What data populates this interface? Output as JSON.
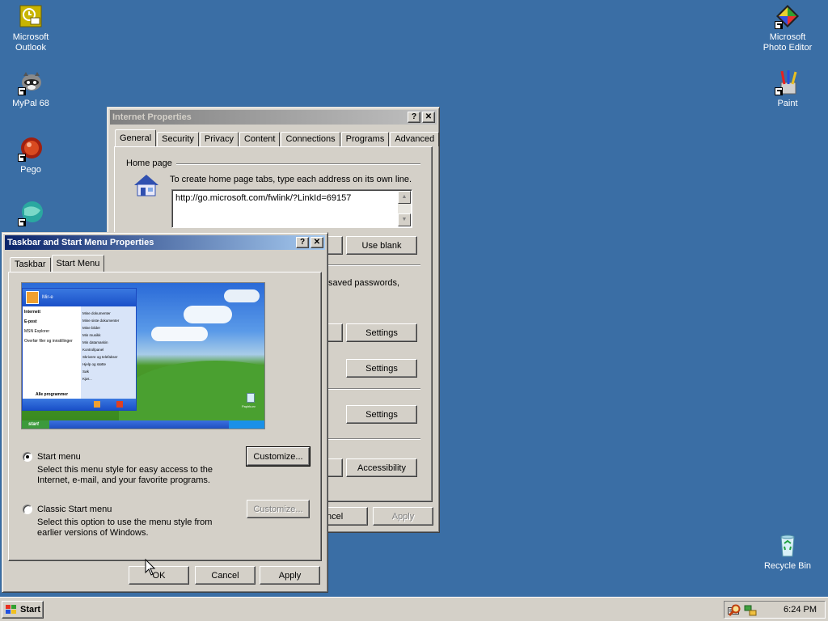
{
  "desktop": {
    "icons_left": [
      {
        "label_1": "Microsoft",
        "label_2": "Outlook"
      },
      {
        "label_1": "MyPal 68",
        "label_2": ""
      },
      {
        "label_1": "Pego",
        "label_2": ""
      }
    ],
    "icons_right": [
      {
        "label_1": "Microsoft",
        "label_2": "Photo Editor"
      },
      {
        "label_1": "Paint",
        "label_2": ""
      },
      {
        "label_1": "Recycle Bin",
        "label_2": ""
      }
    ]
  },
  "internet_properties": {
    "title": "Internet Properties",
    "tabs": [
      "General",
      "Security",
      "Privacy",
      "Content",
      "Connections",
      "Programs",
      "Advanced"
    ],
    "home_page_label": "Home page",
    "home_page_hint": "To create home page tabs, type each address on its own line.",
    "home_page_url": "http://go.microsoft.com/fwlink/?LinkId=69157",
    "use_blank": "Use blank",
    "saved_passwords_fragment": "saved passwords,",
    "settings_1": "Settings",
    "settings_2": "Settings",
    "settings_3": "Settings",
    "accessibility": "Accessibility",
    "cancel_fragment": "ncel",
    "apply": "Apply"
  },
  "taskbar_properties": {
    "title": "Taskbar and Start Menu Properties",
    "tabs": [
      "Taskbar",
      "Start Menu"
    ],
    "preview": {
      "user": "Mir-e",
      "left_items": [
        "Internett",
        "E-post",
        "MSN Explorer",
        "Overfør filer og innstillinger"
      ],
      "right_items": [
        "Mine dokumenter",
        "Mine siste dokumenter",
        "Mine bilder",
        "Min musikk",
        "Min datamaskin",
        "Kontrollpanel",
        "Skrivere og telefakser",
        "Hjelp og støtte",
        "Søk",
        "Kjør..."
      ],
      "all_programs": "Alle programmer",
      "start_label": "start",
      "recycle_label": "Papirkurv"
    },
    "start_menu_label": "Start menu",
    "start_menu_desc_1": "Select this menu style for easy access to the",
    "start_menu_desc_2": "Internet, e-mail, and your favorite programs.",
    "classic_label": "Classic Start menu",
    "classic_desc_1": "Select this option to use the menu style from",
    "classic_desc_2": "earlier versions of Windows.",
    "customize_1": "Customize...",
    "customize_2": "Customize...",
    "ok": "OK",
    "cancel": "Cancel",
    "apply": "Apply"
  },
  "taskbar": {
    "start": "Start",
    "clock": "6:24 PM"
  }
}
